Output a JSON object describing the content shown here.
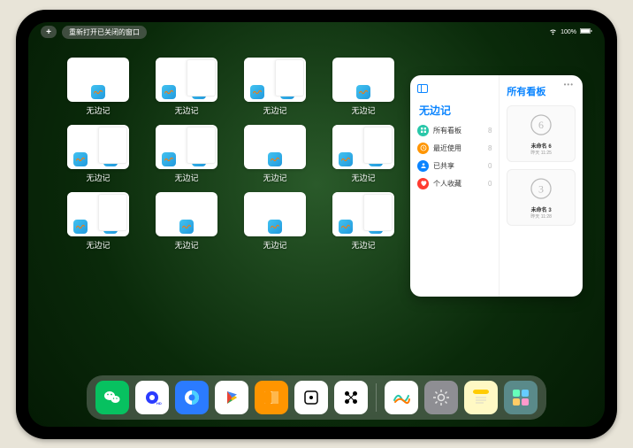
{
  "statusbar": {
    "reopen_label": "重新打开已关闭的窗口",
    "plus": "+",
    "battery_pct": "100%"
  },
  "app_name": "无边记",
  "panel": {
    "left_title": "无边记",
    "categories": [
      {
        "label": "所有看板",
        "count": 8,
        "color": "#29c7a9",
        "icon": "grid"
      },
      {
        "label": "最近使用",
        "count": 8,
        "color": "#ff9500",
        "icon": "clock"
      },
      {
        "label": "已共享",
        "count": 0,
        "color": "#0a84ff",
        "icon": "person"
      },
      {
        "label": "个人收藏",
        "count": 0,
        "color": "#ff3b30",
        "icon": "heart"
      }
    ],
    "right_title": "所有看板",
    "cards": [
      {
        "sketch": "6",
        "name": "未命名 6",
        "date": "昨天 11:25"
      },
      {
        "sketch": "3",
        "name": "未命名 3",
        "date": "昨天 11:28"
      }
    ]
  },
  "grid": {
    "items": [
      {
        "label": "无边记",
        "variant": "blank"
      },
      {
        "label": "无边记",
        "variant": "stacked"
      },
      {
        "label": "无边记",
        "variant": "stacked"
      },
      {
        "label": "无边记",
        "variant": "blank"
      },
      {
        "label": "无边记",
        "variant": "stacked"
      },
      {
        "label": "无边记",
        "variant": "stacked"
      },
      {
        "label": "无边记",
        "variant": "blank"
      },
      {
        "label": "无边记",
        "variant": "stacked"
      },
      {
        "label": "无边记",
        "variant": "stacked"
      },
      {
        "label": "无边记",
        "variant": "blank"
      },
      {
        "label": "无边记",
        "variant": "blank"
      },
      {
        "label": "无边记",
        "variant": "stacked"
      }
    ]
  },
  "dock": {
    "apps": [
      {
        "name": "wechat",
        "bg": "#07c160"
      },
      {
        "name": "quark",
        "bg": "#ffffff"
      },
      {
        "name": "qqbrowser",
        "bg": "#2b7bff"
      },
      {
        "name": "play",
        "bg": "#ffffff"
      },
      {
        "name": "books",
        "bg": "#ff9500"
      },
      {
        "name": "dice",
        "bg": "#ffffff"
      },
      {
        "name": "linker",
        "bg": "#ffffff"
      }
    ],
    "recent": [
      {
        "name": "freeform",
        "bg": "#ffffff"
      },
      {
        "name": "settings",
        "bg": "#8e8e93"
      },
      {
        "name": "notes",
        "bg": "#fff9c4"
      },
      {
        "name": "app-library",
        "bg": "#5a8a8a"
      }
    ]
  }
}
